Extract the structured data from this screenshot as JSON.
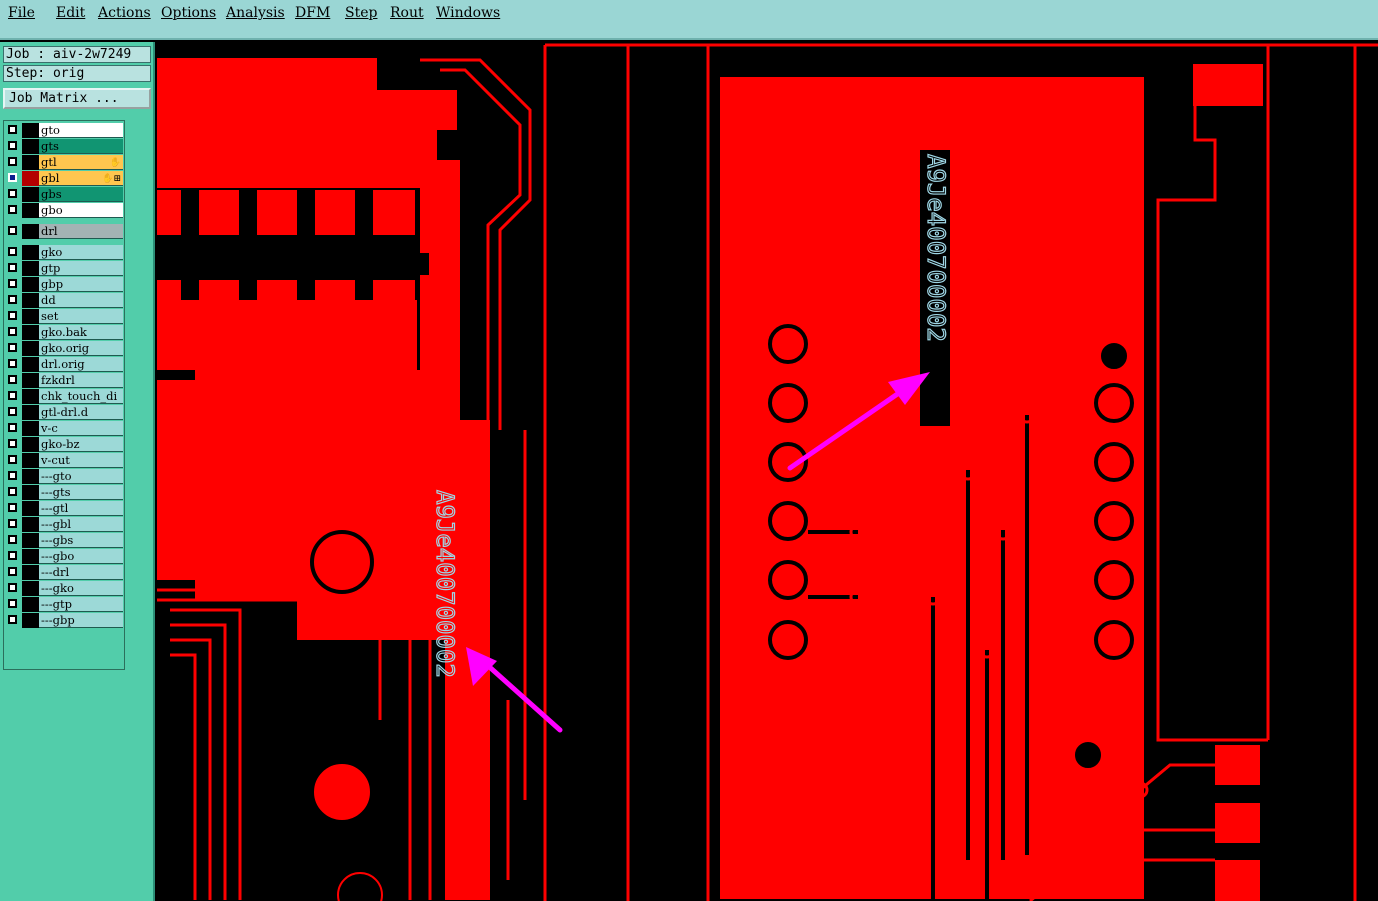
{
  "menu": [
    "File",
    "Edit",
    "Actions",
    "Options",
    "Analysis",
    "DFM",
    "Step",
    "Rout",
    "Windows"
  ],
  "job_label": "Job : aiv-2w7249",
  "step_label": "Step: orig",
  "job_matrix_button": "Job Matrix ...",
  "layers": [
    {
      "name": "gto",
      "color": "#ffffff"
    },
    {
      "name": "gts",
      "color": "#119572"
    },
    {
      "name": "gtl",
      "color": "#ffc64f",
      "mark": "✋"
    },
    {
      "name": "gbl",
      "color": "#ffc64f",
      "mark": "✋⊞",
      "active": true
    },
    {
      "name": "gbs",
      "color": "#119572"
    },
    {
      "name": "gbo",
      "color": "#ffffff"
    },
    {
      "name": "drl",
      "color": "#a3b3b4"
    },
    {
      "name": "gko",
      "color": "#9cd9d7"
    },
    {
      "name": "gtp",
      "color": "#9cd9d7"
    },
    {
      "name": "gbp",
      "color": "#9cd9d7"
    },
    {
      "name": "dd",
      "color": "#9cd9d7"
    },
    {
      "name": "set",
      "color": "#9cd9d7"
    },
    {
      "name": "gko.bak",
      "color": "#9cd9d7"
    },
    {
      "name": "gko.orig",
      "color": "#9cd9d7"
    },
    {
      "name": "drl.orig",
      "color": "#9cd9d7"
    },
    {
      "name": "fzkdrl",
      "color": "#9cd9d7"
    },
    {
      "name": "chk_touch_di",
      "color": "#9cd9d7"
    },
    {
      "name": "gtl-drl.d",
      "color": "#9cd9d7"
    },
    {
      "name": "v-c",
      "color": "#9cd9d7"
    },
    {
      "name": "gko-bz",
      "color": "#9cd9d7"
    },
    {
      "name": "v-cut",
      "color": "#9cd9d7"
    },
    {
      "name": "---gto",
      "color": "#9cd9d7"
    },
    {
      "name": "---gts",
      "color": "#9cd9d7"
    },
    {
      "name": "---gtl",
      "color": "#9cd9d7"
    },
    {
      "name": "---gbl",
      "color": "#9cd9d7"
    },
    {
      "name": "---gbs",
      "color": "#9cd9d7"
    },
    {
      "name": "---gbo",
      "color": "#9cd9d7"
    },
    {
      "name": "---drl",
      "color": "#9cd9d7"
    },
    {
      "name": "---gko",
      "color": "#9cd9d7"
    },
    {
      "name": "---gtp",
      "color": "#9cd9d7"
    },
    {
      "name": "---gbp",
      "color": "#9cd9d7"
    }
  ],
  "board": {
    "copper_color": "#ff0000",
    "background_color": "#000000",
    "annotation_color": "#ff00ff",
    "silk_text_right": "A9Je400700002",
    "silk_text_left": "A9Je400700002"
  }
}
